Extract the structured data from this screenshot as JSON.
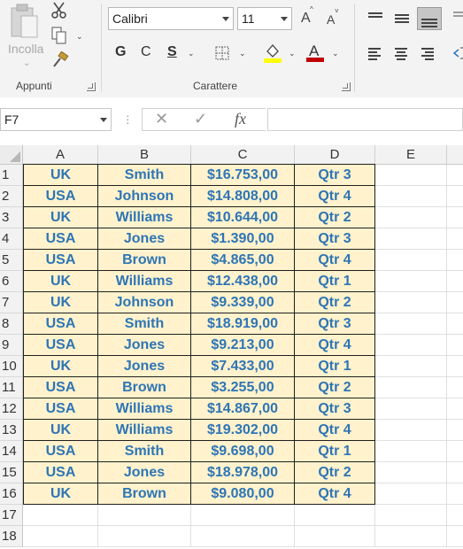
{
  "ribbon": {
    "clipboard": {
      "paste_label": "Incolla",
      "group_label": "Appunti"
    },
    "font": {
      "font_name": "Calibri",
      "font_size": "11",
      "grow_label": "A",
      "shrink_label": "A",
      "bold_label": "G",
      "italic_label": "C",
      "underline_label": "S",
      "group_label": "Carattere",
      "fill_color": "#ffff00",
      "font_color": "#c00000"
    }
  },
  "formula_bar": {
    "name_box": "F7",
    "fx_label": "fx",
    "formula": ""
  },
  "sheet": {
    "columns": [
      "A",
      "B",
      "C",
      "D",
      "E"
    ],
    "rows": [
      "1",
      "2",
      "3",
      "4",
      "5",
      "6",
      "7",
      "8",
      "9",
      "10",
      "11",
      "12",
      "13",
      "14",
      "15",
      "16",
      "17",
      "18"
    ],
    "data": [
      [
        "UK",
        "Smith",
        "$16.753,00",
        "Qtr 3"
      ],
      [
        "USA",
        "Johnson",
        "$14.808,00",
        "Qtr 4"
      ],
      [
        "UK",
        "Williams",
        "$10.644,00",
        "Qtr 2"
      ],
      [
        "USA",
        "Jones",
        "$1.390,00",
        "Qtr 3"
      ],
      [
        "USA",
        "Brown",
        "$4.865,00",
        "Qtr 4"
      ],
      [
        "UK",
        "Williams",
        "$12.438,00",
        "Qtr 1"
      ],
      [
        "UK",
        "Johnson",
        "$9.339,00",
        "Qtr 2"
      ],
      [
        "USA",
        "Smith",
        "$18.919,00",
        "Qtr 3"
      ],
      [
        "USA",
        "Jones",
        "$9.213,00",
        "Qtr 4"
      ],
      [
        "UK",
        "Jones",
        "$7.433,00",
        "Qtr 1"
      ],
      [
        "USA",
        "Brown",
        "$3.255,00",
        "Qtr 2"
      ],
      [
        "USA",
        "Williams",
        "$14.867,00",
        "Qtr 3"
      ],
      [
        "UK",
        "Williams",
        "$19.302,00",
        "Qtr 4"
      ],
      [
        "USA",
        "Smith",
        "$9.698,00",
        "Qtr 1"
      ],
      [
        "USA",
        "Jones",
        "$18.978,00",
        "Qtr 2"
      ],
      [
        "UK",
        "Brown",
        "$9.080,00",
        "Qtr 4"
      ]
    ],
    "cell_fill": "#fff2cc",
    "cell_text_color": "#2e75b6"
  }
}
